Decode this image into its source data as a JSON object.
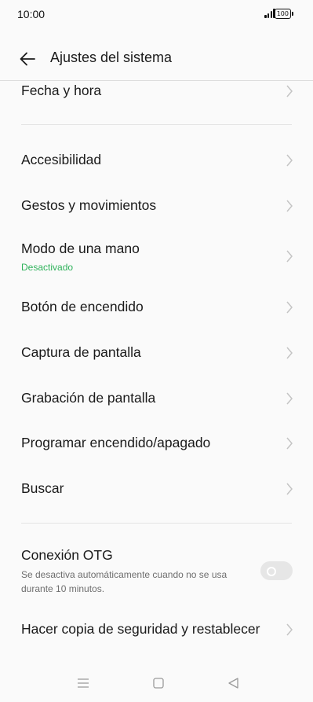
{
  "status_bar": {
    "time": "10:00",
    "battery": "100"
  },
  "header": {
    "title": "Ajustes del sistema"
  },
  "items": {
    "fecha": {
      "label": "Fecha y hora"
    },
    "accesibilidad": {
      "label": "Accesibilidad"
    },
    "gestos": {
      "label": "Gestos y movimientos"
    },
    "modo_mano": {
      "label": "Modo de una mano",
      "status": "Desactivado"
    },
    "boton": {
      "label": "Botón de encendido"
    },
    "captura": {
      "label": "Captura de pantalla"
    },
    "grabacion": {
      "label": "Grabación de pantalla"
    },
    "programar": {
      "label": "Programar encendido/apagado"
    },
    "buscar": {
      "label": "Buscar"
    },
    "otg": {
      "label": "Conexión OTG",
      "description": "Se desactiva automáticamente cuando no se usa durante 10 minutos.",
      "enabled": false
    },
    "copia": {
      "label": "Hacer copia de seguridad y restablecer"
    }
  },
  "colors": {
    "accent_green": "#2fb25b",
    "background": "#fafafa"
  },
  "icons": {
    "back": "arrow-left-icon",
    "chevron": "chevron-right-icon",
    "nav_menu": "menu-icon",
    "nav_home": "home-icon",
    "nav_back": "back-triangle-icon"
  }
}
